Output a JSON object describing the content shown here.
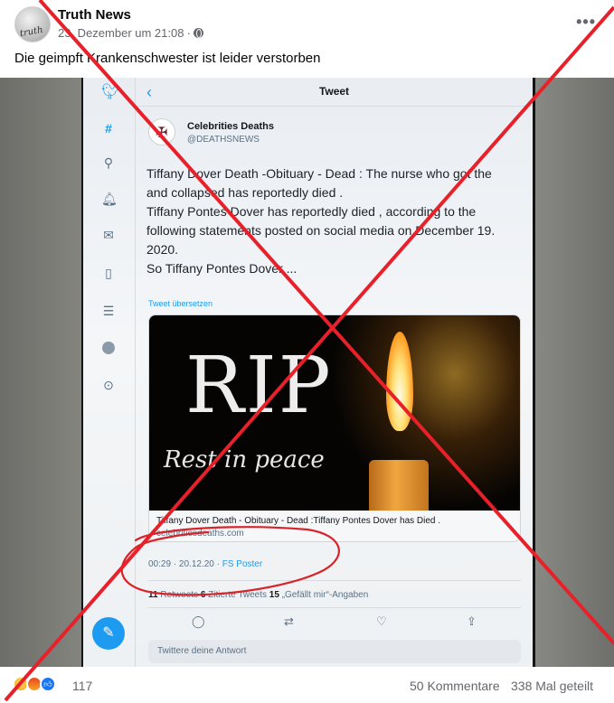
{
  "post": {
    "page_name": "Truth News",
    "date": "23. Dezember um 21:08",
    "separator": "·",
    "caption": "Die geimpft Krankenschwester ist leider verstorben",
    "avatar_text": "truth"
  },
  "tweet": {
    "header_title": "Tweet",
    "account_name": "Celebrities Deaths",
    "account_handle": "@DEATHSNEWS",
    "lines": [
      "Tiffany Dover Death -Obituary - Dead : The nurse who got the",
      "and collapsed has reportedly  died .",
      "Tiffany Pontes Dover has reportedly died , according to the",
      "following statements posted on social media on December 19.",
      "2020.",
      "So Tiffany Pontes Dover ..."
    ],
    "translate_label": "Tweet übersetzen",
    "card_image_text": "RIP",
    "card_image_subtext": "Rest in peace",
    "card_title": "Tiffany Dover Death - Obituary - Dead :Tiffany Pontes Dover has Died .",
    "card_domain": "celebritiesdeaths.com",
    "timestamp": "00:29 · 20.12.20 · ",
    "source": "FS Poster",
    "stats": {
      "retweets_count": "11",
      "retweets_label": " Retweets  ",
      "quotes_count": "6",
      "quotes_label": " Zitierte Tweets  ",
      "likes_count": "15",
      "likes_label": " „Gefällt mir“-Angaben"
    },
    "reply_placeholder": "Twittere deine Antwort"
  },
  "footer": {
    "reaction_count": "117",
    "comments": "50 Kommentare",
    "shares": "338 Mal geteilt"
  },
  "colors": {
    "twitter_blue": "#1d9bf0",
    "facebook_blue": "#1877f2",
    "overlay_red": "#e8202a",
    "annotation_red": "#d8232a"
  },
  "icons": {
    "sidebar": [
      "twitter-bird-icon",
      "hashtag-icon",
      "search-icon",
      "bell-icon",
      "mail-icon",
      "bookmark-icon",
      "list-icon",
      "profile-avatar-icon",
      "more-circle-icon"
    ],
    "actions": [
      "reply-icon",
      "retweet-icon",
      "like-icon",
      "share-icon"
    ]
  }
}
